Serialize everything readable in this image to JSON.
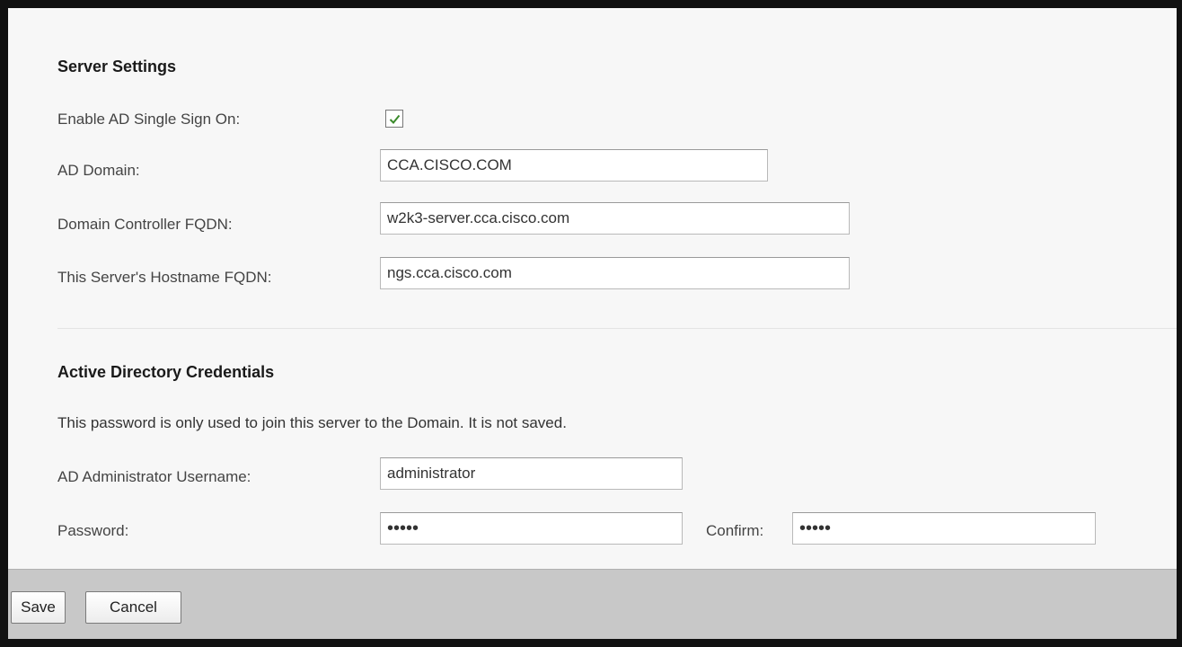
{
  "server_settings": {
    "title": "Server Settings",
    "enable_sso_label": "Enable AD Single Sign On:",
    "enable_sso_checked": true,
    "ad_domain_label": "AD Domain:",
    "ad_domain_value": "CCA.CISCO.COM",
    "dc_fqdn_label": "Domain Controller FQDN:",
    "dc_fqdn_value": "w2k3-server.cca.cisco.com",
    "hostname_fqdn_label": "This Server's Hostname FQDN:",
    "hostname_fqdn_value": "ngs.cca.cisco.com"
  },
  "credentials": {
    "title": "Active Directory Credentials",
    "note": "This password is only used to join this server to the Domain. It is not saved.",
    "username_label": "AD Administrator Username:",
    "username_value": "administrator",
    "password_label": "Password:",
    "password_value": "•••••",
    "confirm_label": "Confirm:",
    "confirm_value": "•••••"
  },
  "footer": {
    "save_label": "Save",
    "cancel_label": "Cancel"
  },
  "icons": {
    "checkmark": "check-icon"
  },
  "colors": {
    "checkmark": "#3a8a2a",
    "footer_bg": "#c8c8c8",
    "window_frame": "#111111"
  }
}
